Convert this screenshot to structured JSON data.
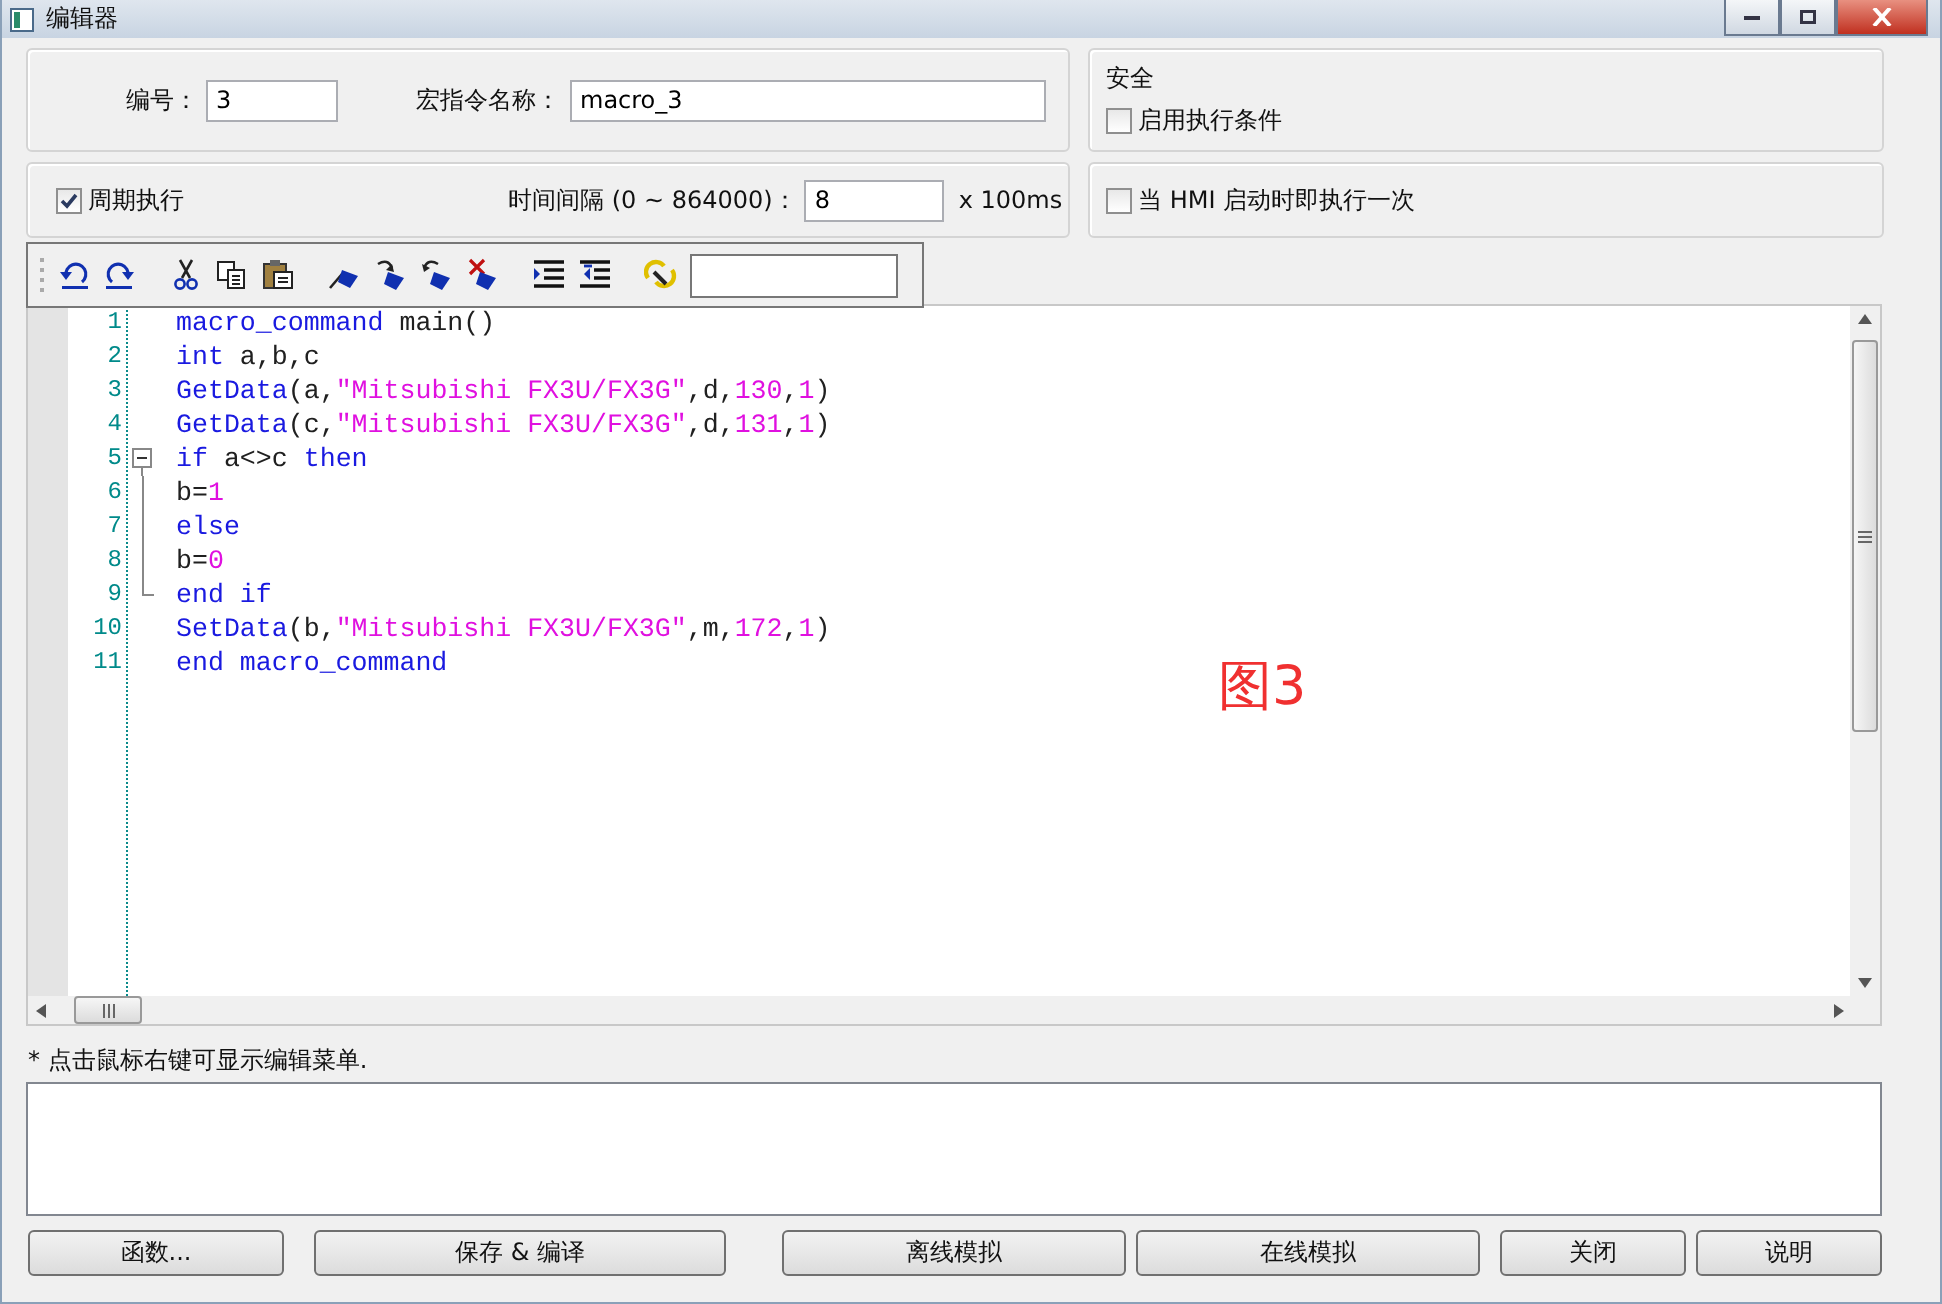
{
  "window": {
    "title": "编辑器"
  },
  "settings": {
    "number_label": "编号：",
    "number_value": "3",
    "name_label": "宏指令名称：",
    "name_value": "macro_3",
    "periodic": {
      "label": "周期执行",
      "checked": true
    },
    "interval_label": "时间间隔 (0 ~ 864000)：",
    "interval_value": "8",
    "interval_unit": "x 100ms"
  },
  "security": {
    "title": "安全",
    "enable_condition": {
      "label": "启用执行条件",
      "checked": false
    },
    "run_once": {
      "label": "当 HMI 启动时即执行一次",
      "checked": false
    }
  },
  "editor": {
    "lines": [
      {
        "number": "1",
        "kind": "plain",
        "tokens": [
          {
            "kind": "kw",
            "text": "macro_command"
          },
          {
            "kind": "plain",
            "text": " main()"
          }
        ]
      },
      {
        "number": "2",
        "kind": "plain",
        "tokens": [
          {
            "kind": "kw",
            "text": "int"
          },
          {
            "kind": "plain",
            "text": " a,b,c"
          }
        ]
      },
      {
        "number": "3",
        "kind": "plain",
        "tokens": [
          {
            "kind": "kw",
            "text": "GetData"
          },
          {
            "kind": "plain",
            "text": "(a,"
          },
          {
            "kind": "str",
            "text": "\"Mitsubishi FX3U/FX3G\""
          },
          {
            "kind": "plain",
            "text": ",d,"
          },
          {
            "kind": "num",
            "text": "130"
          },
          {
            "kind": "plain",
            "text": ","
          },
          {
            "kind": "num",
            "text": "1"
          },
          {
            "kind": "plain",
            "text": ")"
          }
        ]
      },
      {
        "number": "4",
        "kind": "plain",
        "tokens": [
          {
            "kind": "kw",
            "text": "GetData"
          },
          {
            "kind": "plain",
            "text": "(c,"
          },
          {
            "kind": "str",
            "text": "\"Mitsubishi FX3U/FX3G\""
          },
          {
            "kind": "plain",
            "text": ",d,"
          },
          {
            "kind": "num",
            "text": "131"
          },
          {
            "kind": "plain",
            "text": ","
          },
          {
            "kind": "num",
            "text": "1"
          },
          {
            "kind": "plain",
            "text": ")"
          }
        ]
      },
      {
        "number": "5",
        "kind": "foldstart",
        "tokens": [
          {
            "kind": "kw",
            "text": "if"
          },
          {
            "kind": "plain",
            "text": " a<>c "
          },
          {
            "kind": "kw",
            "text": "then"
          }
        ]
      },
      {
        "number": "6",
        "kind": "foldbody",
        "tokens": [
          {
            "kind": "plain",
            "text": "b="
          },
          {
            "kind": "num",
            "text": "1"
          }
        ]
      },
      {
        "number": "7",
        "kind": "foldbody",
        "tokens": [
          {
            "kind": "kw",
            "text": "else"
          }
        ]
      },
      {
        "number": "8",
        "kind": "foldbody",
        "tokens": [
          {
            "kind": "plain",
            "text": "b="
          },
          {
            "kind": "num",
            "text": "0"
          }
        ]
      },
      {
        "number": "9",
        "kind": "foldend",
        "tokens": [
          {
            "kind": "kw",
            "text": "end if"
          }
        ]
      },
      {
        "number": "10",
        "kind": "plain",
        "tokens": [
          {
            "kind": "kw",
            "text": "SetData"
          },
          {
            "kind": "plain",
            "text": "(b,"
          },
          {
            "kind": "str",
            "text": "\"Mitsubishi FX3U/FX3G\""
          },
          {
            "kind": "plain",
            "text": ",m,"
          },
          {
            "kind": "num",
            "text": "172"
          },
          {
            "kind": "plain",
            "text": ","
          },
          {
            "kind": "num",
            "text": "1"
          },
          {
            "kind": "plain",
            "text": ")"
          }
        ]
      },
      {
        "number": "11",
        "kind": "plain",
        "tokens": [
          {
            "kind": "kw",
            "text": "end macro_command"
          }
        ]
      }
    ]
  },
  "annotation": "图3",
  "hint": "* 点击鼠标右键可显示编辑菜单.",
  "buttons": [
    "函数...",
    "保存 & 编译",
    "离线模拟",
    "在线模拟",
    "关闭",
    "说明"
  ]
}
